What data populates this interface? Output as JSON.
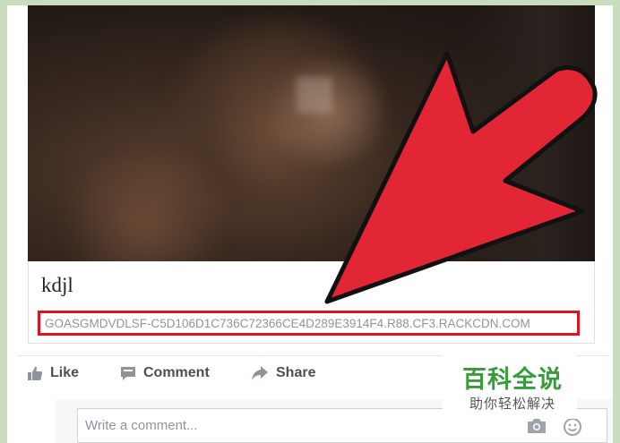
{
  "post": {
    "link_title": "kdjl",
    "link_url": "GOASGMDVDLSF-C5D106D1C736C72366CE4D289E3914F4.R88.CF3.RACKCDN.COM"
  },
  "actions": {
    "like_label": "Like",
    "comment_label": "Comment",
    "share_label": "Share"
  },
  "comment_box": {
    "placeholder": "Write a comment..."
  },
  "annotation": {
    "highlight_color": "#e0121b",
    "arrow_color": "#e32636"
  },
  "watermark": {
    "title": "百科全说",
    "subtitle": "助你轻松解决"
  }
}
